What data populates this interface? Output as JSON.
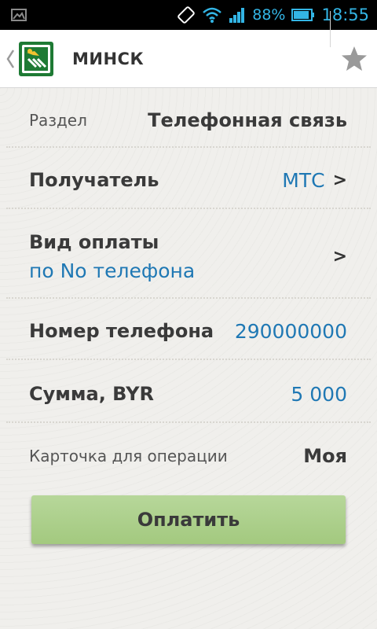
{
  "status_bar": {
    "battery": "88%",
    "time": "18:55",
    "icons": [
      "image-icon",
      "rotate-icon",
      "wifi-icon",
      "signal-icon",
      "battery-icon"
    ]
  },
  "action_bar": {
    "title": "МИНСК",
    "back_icon": "chevron-left-icon",
    "favorite_icon": "star-icon"
  },
  "form": {
    "section_label": "Раздел",
    "section_value": "Телефонная связь",
    "recipient_label": "Получатель",
    "recipient_value": "МТС",
    "payment_type_label": "Вид оплаты",
    "payment_type_value": "по No телефона",
    "phone_label": "Номер телефона",
    "phone_value": "290000000",
    "amount_label": "Сумма, BYR",
    "amount_value": "5 000",
    "card_label": "Карточка для операции",
    "card_value": "Моя",
    "chevron": ">"
  },
  "actions": {
    "pay_label": "Оплатить"
  },
  "colors": {
    "accent_blue": "#1f78b4",
    "status_blue": "#33b5e5",
    "button_green": "#a9cd86",
    "logo_green": "#1e7a34"
  }
}
